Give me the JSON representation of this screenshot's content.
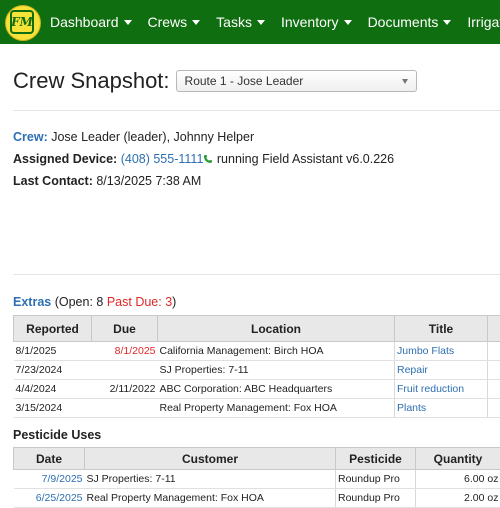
{
  "nav": {
    "logo_text": "FM",
    "items": [
      {
        "label": "Dashboard"
      },
      {
        "label": "Crews"
      },
      {
        "label": "Tasks"
      },
      {
        "label": "Inventory"
      },
      {
        "label": "Documents"
      },
      {
        "label": "Irrigation"
      }
    ]
  },
  "page": {
    "title": "Crew Snapshot:",
    "crew_select": "Route 1 - Jose Leader"
  },
  "crew_info": {
    "crew_label": "Crew:",
    "crew_value": "Jose Leader (leader), Johnny Helper",
    "device_label": "Assigned Device:",
    "device_phone": "(408) 555-1111",
    "device_app": "running Field Assistant v6.0.226",
    "last_contact_label": "Last Contact:",
    "last_contact_value": "8/13/2025 7:38 AM"
  },
  "extras": {
    "label": "Extras",
    "open_text": "(Open: 8",
    "past_due_text": "Past Due: 3",
    "close_paren": ")",
    "columns": [
      "Reported",
      "Due",
      "Location",
      "Title"
    ],
    "rows": [
      {
        "reported": "8/1/2025",
        "due": "8/1/2025",
        "due_overdue": true,
        "location": "California Management: Birch HOA",
        "title": "Jumbo Flats"
      },
      {
        "reported": "7/23/2024",
        "due": "",
        "due_overdue": false,
        "location": "SJ Properties: 7-11",
        "title": "Repair"
      },
      {
        "reported": "4/4/2024",
        "due": "2/11/2022",
        "due_overdue": false,
        "location": "ABC Corporation: ABC Headquarters",
        "title": "Fruit reduction"
      },
      {
        "reported": "3/15/2024",
        "due": "",
        "due_overdue": false,
        "location": "Real Property Management: Fox HOA",
        "title": "Plants"
      }
    ]
  },
  "pesticide": {
    "label": "Pesticide Uses",
    "columns": [
      "Date",
      "Customer",
      "Pesticide",
      "Quantity"
    ],
    "rows": [
      {
        "date": "7/9/2025",
        "customer": "SJ Properties: 7-11",
        "pesticide": "Roundup Pro",
        "quantity": "6.00 oz"
      },
      {
        "date": "6/25/2025",
        "customer": "Real Property Management: Fox HOA",
        "pesticide": "Roundup Pro",
        "quantity": "2.00 oz"
      }
    ]
  },
  "colors": {
    "navbar": "#0f6e0f",
    "logo": "#f7e23a",
    "link": "#2d6fb2",
    "overdue": "#e02828"
  }
}
